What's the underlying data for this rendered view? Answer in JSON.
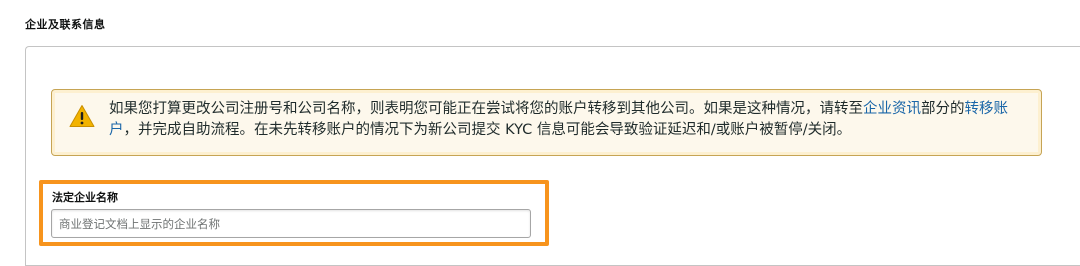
{
  "section": {
    "title": "企业及联系信息"
  },
  "alert": {
    "icon": "warning-icon",
    "text_part1": "如果您打算更改公司注册号和公司名称，则表明您可能正在尝试将您的账户转移到其他公司。如果是这种情况，请转至",
    "link1": "企业资讯",
    "text_part2": "部分的",
    "link2": "转移账户",
    "text_part3": "，并完成自助流程。在未先转移账户的情况下为新公司提交 KYC 信息可能会导致验证延迟和/或账户被暂停/关闭。",
    "colors": {
      "border": "#c6a454",
      "background": "#fdf8ec",
      "link": "#1a66a8"
    }
  },
  "legal_name_field": {
    "label": "法定企业名称",
    "value": "",
    "placeholder": "商业登记文档上显示的企业名称",
    "highlight_color": "#f7941d"
  }
}
